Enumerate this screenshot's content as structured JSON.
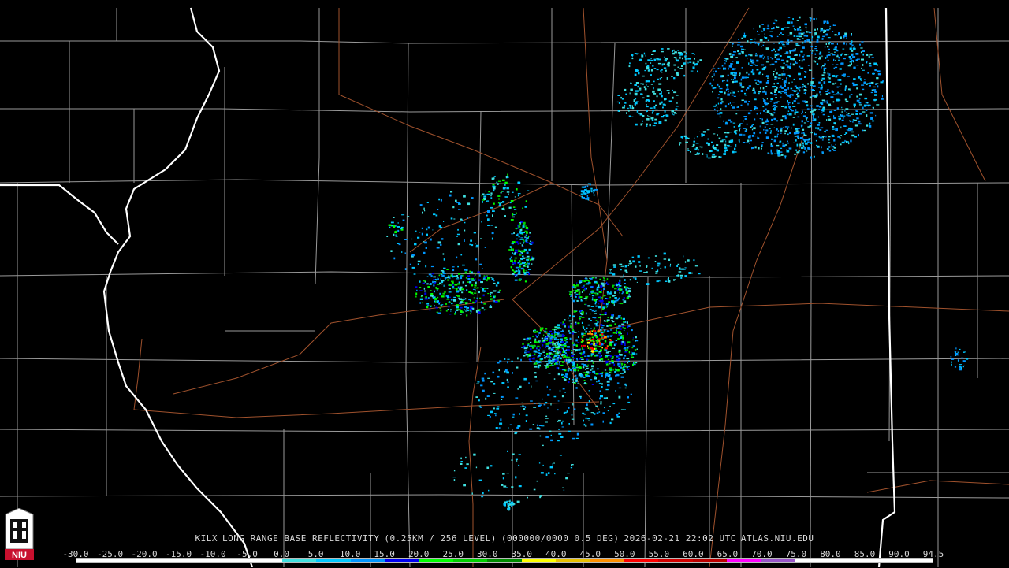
{
  "product": {
    "station": "KILX",
    "title": "LONG RANGE BASE REFLECTIVITY",
    "params": "(0.25KM / 256 LEVEL)",
    "volume": "(000000/0000 0.5 DEG)",
    "timestamp": "2026-02-21 22:02 UTC",
    "source": "ATLAS.NIU.EDU"
  },
  "logo": {
    "text": "NIU",
    "icon": "niu-tower-icon",
    "color": "#c8102e"
  },
  "legend": {
    "labels": [
      "-30.0",
      "-25.0",
      "-20.0",
      "-15.0",
      "-10.0",
      "-5.0",
      "0.0",
      "5.0",
      "10.0",
      "15.0",
      "20.0",
      "25.0",
      "30.0",
      "35.0",
      "40.0",
      "45.0",
      "50.0",
      "55.0",
      "60.0",
      "65.0",
      "70.0",
      "75.0",
      "80.0",
      "85.0",
      "90.0",
      "94.5"
    ],
    "colors": [
      "#ffffff",
      "#ffffff",
      "#ffffff",
      "#ffffff",
      "#ffffff",
      "#ffffff",
      "#40e0e0",
      "#00c8ff",
      "#0096ff",
      "#0000f0",
      "#00ff00",
      "#00d000",
      "#008c00",
      "#ffff00",
      "#e8c000",
      "#ff9000",
      "#ff0000",
      "#d40000",
      "#bc0000",
      "#ff00ff",
      "#9955c9",
      "#ffffff",
      "#ffffff",
      "#ffffff",
      "#ffffff"
    ]
  },
  "map_colors": {
    "county_lines": "#9a9a9a",
    "state_lines": "#ffffff",
    "highways": "#a0522d",
    "background": "#000000"
  }
}
